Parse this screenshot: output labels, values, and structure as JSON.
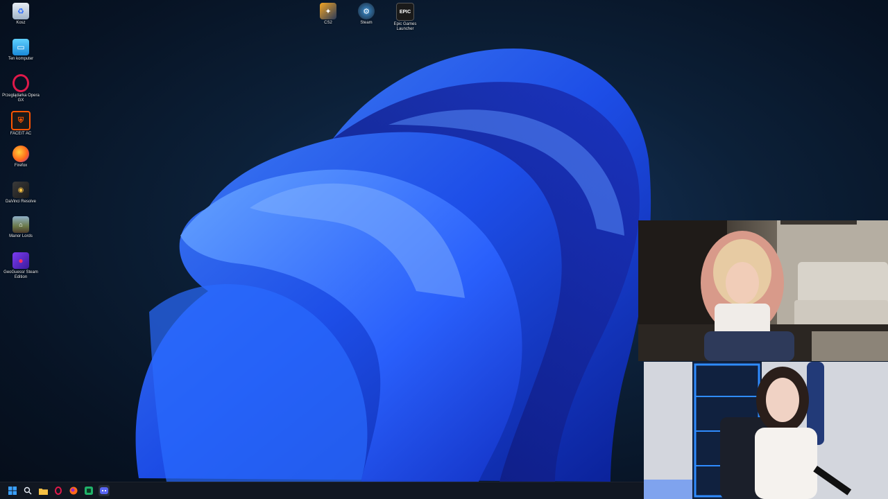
{
  "desktop": {
    "left_icons": [
      {
        "label": "Kosz",
        "icon": "recycle-bin-icon"
      },
      {
        "label": "Ten komputer",
        "icon": "computer-icon"
      },
      {
        "label": "Przeglądarka Opera GX",
        "icon": "opera-gx-icon"
      },
      {
        "label": "FACEIT AC",
        "icon": "faceit-icon"
      },
      {
        "label": "Firefox",
        "icon": "firefox-icon"
      },
      {
        "label": "DaVinci Resolve",
        "icon": "davinci-icon"
      },
      {
        "label": "Manor Lords",
        "icon": "manor-lords-icon"
      },
      {
        "label": "GeoGuessr Steam Edition",
        "icon": "geoguessr-icon"
      }
    ],
    "top_icons": [
      {
        "label": "CS2",
        "icon": "cs2-icon"
      },
      {
        "label": "Steam",
        "icon": "steam-icon"
      },
      {
        "label": "Epic Games Launcher",
        "icon": "epic-games-icon",
        "glyph": "EPIC"
      }
    ]
  },
  "taskbar": {
    "items": [
      {
        "name": "start-button",
        "icon": "windows-icon"
      },
      {
        "name": "search-button",
        "icon": "search-icon"
      },
      {
        "name": "file-explorer-button",
        "icon": "folder-icon"
      },
      {
        "name": "opera-gx-taskbar-button",
        "icon": "opera-gx-icon"
      },
      {
        "name": "firefox-taskbar-button",
        "icon": "firefox-icon"
      },
      {
        "name": "app-taskbar-button",
        "icon": "app-icon"
      },
      {
        "name": "discord-taskbar-button",
        "icon": "discord-icon"
      }
    ]
  },
  "colors": {
    "accent": "#1e5cff",
    "taskbar_bg": "#121822"
  }
}
